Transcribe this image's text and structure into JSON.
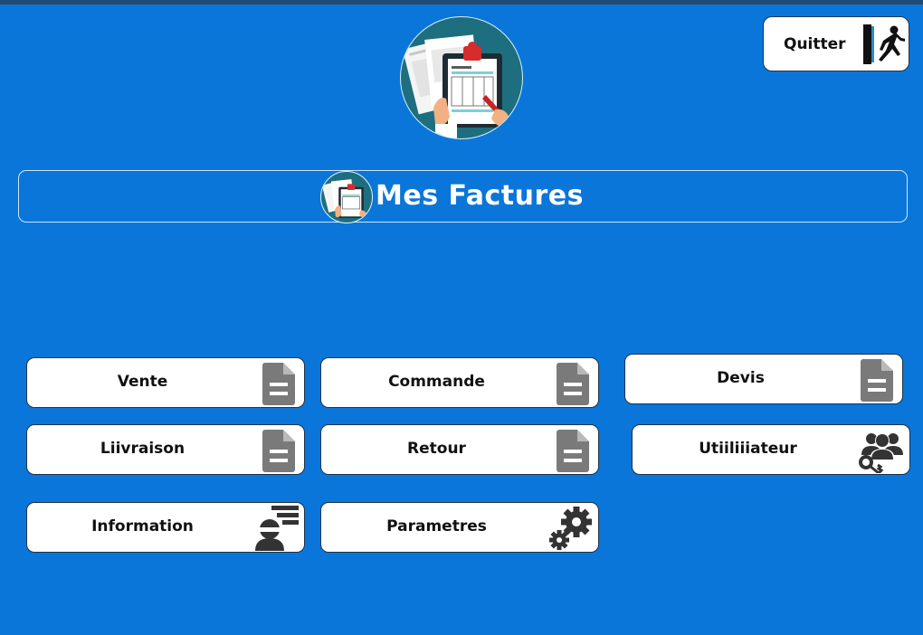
{
  "header": {
    "quit_label": "Quitter",
    "app_title": "Mes Factures"
  },
  "tiles": {
    "vente": "Vente",
    "commande": "Commande",
    "devis": "Devis",
    "livraison": "Liivraison",
    "retour": "Retour",
    "utilisateur": "Utiiliiiateur",
    "information": "Information",
    "parametres": "Parametres"
  },
  "icons": {
    "quit": "exit-door-icon",
    "document": "document-icon",
    "users": "users-key-icon",
    "information": "info-person-icon",
    "settings": "gears-icon"
  },
  "colors": {
    "background": "#0a76d9",
    "top_bar": "#1f4b74",
    "tile_background": "#ffffff",
    "icon_gray": "#7a7a7a",
    "logo_circle": "#1d6f80"
  }
}
